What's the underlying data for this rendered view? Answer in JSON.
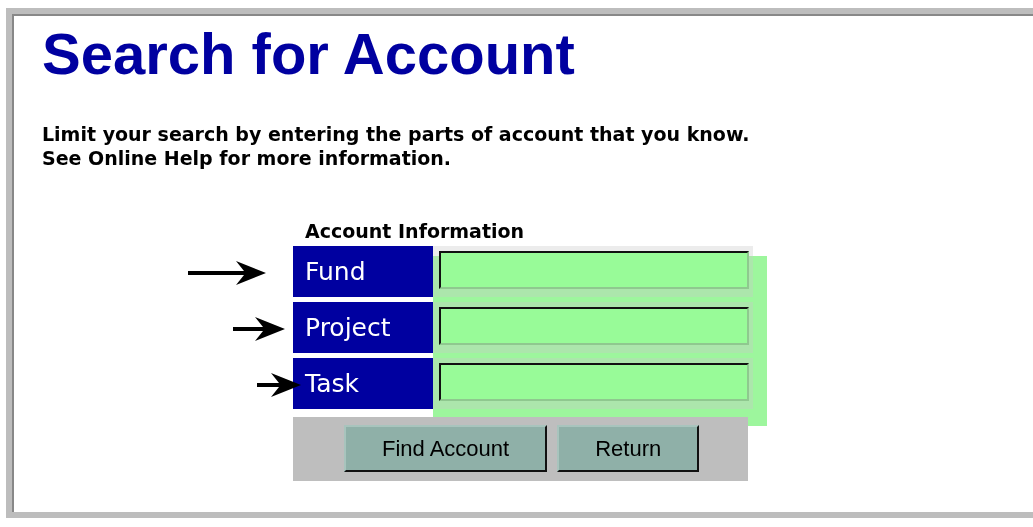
{
  "page": {
    "title": "Search for Account"
  },
  "intro": [
    "Limit your search by entering the parts of account that you know.",
    "See Online Help for more information."
  ],
  "form": {
    "heading": "Account Information",
    "fields": [
      {
        "label": "Fund",
        "marked": true
      },
      {
        "label": "Project",
        "marked": true
      },
      {
        "label": "Task",
        "marked": true
      }
    ],
    "highlighted": true,
    "buttons": [
      "Find Account",
      "Return"
    ]
  }
}
